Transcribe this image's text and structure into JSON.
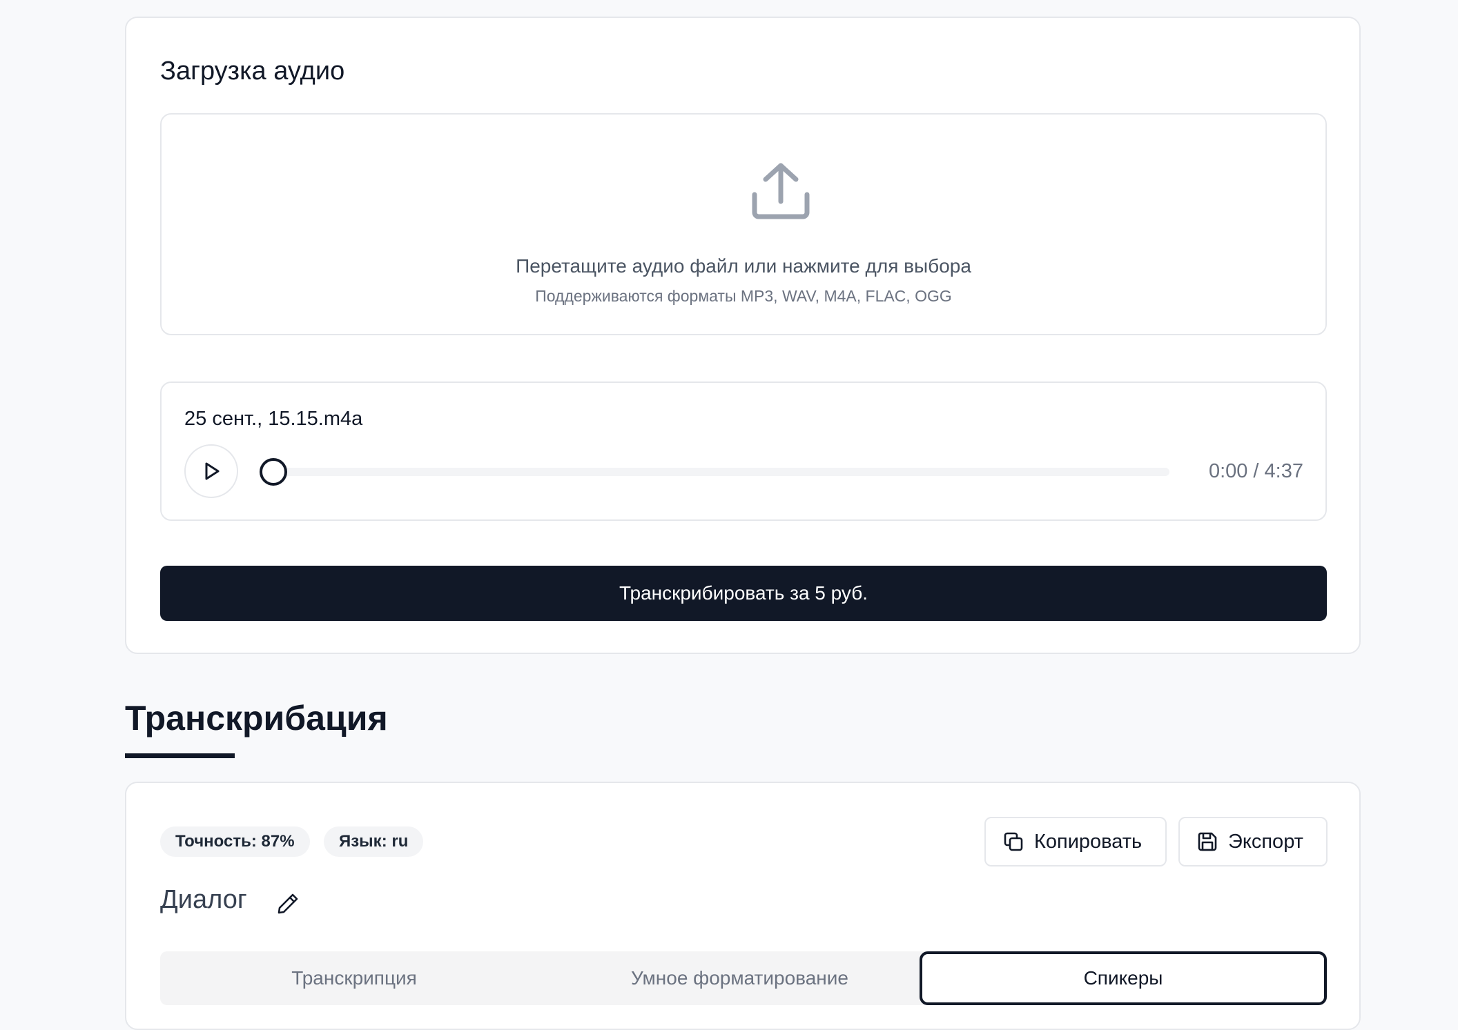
{
  "upload": {
    "title": "Загрузка аудио",
    "dropzone_main": "Перетащите аудио файл или нажмите для выбора",
    "dropzone_sub": "Поддерживаются форматы MP3, WAV, M4A, FLAC, OGG"
  },
  "player": {
    "file_name": "25 сент., 15.15.m4a",
    "time": "0:00 / 4:37",
    "progress": 0
  },
  "transcribe_button": "Транскрибировать за 5 руб.",
  "section": {
    "title": "Транскрибация"
  },
  "result": {
    "accuracy": "Точность: 87%",
    "language": "Язык: ru",
    "copy_label": "Копировать",
    "export_label": "Экспорт",
    "doc_title": "Диалог",
    "tabs": [
      {
        "label": "Транскрипция",
        "active": false
      },
      {
        "label": "Умное форматирование",
        "active": false
      },
      {
        "label": "Спикеры",
        "active": true
      }
    ]
  },
  "colors": {
    "primary": "#111827",
    "background": "#f8f9fb",
    "border": "#e5e7eb",
    "muted": "#6b7280"
  }
}
